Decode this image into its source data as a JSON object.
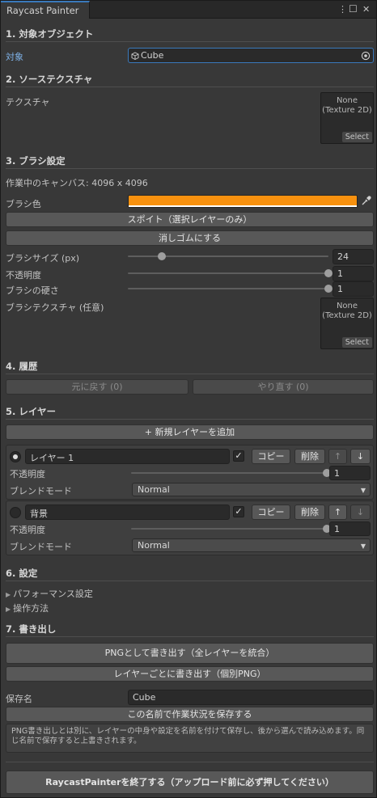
{
  "window": {
    "title": "Raycast Painter",
    "menu_icon": "⋮",
    "maximize_icon": "☐",
    "close_icon": "✕"
  },
  "sections": {
    "target": {
      "header": "1. 対象オブジェクト",
      "label": "対象",
      "value": "Cube",
      "icons": {
        "object": "cube-icon",
        "picker": "object-picker-icon"
      }
    },
    "source": {
      "header": "2. ソーステクスチャ",
      "label": "テクスチャ",
      "thumb_text": "None\n(Texture 2D)",
      "select_label": "Select"
    },
    "brush": {
      "header": "3. ブラシ設定",
      "canvas_info": "作業中のキャンバス: 4096 x 4096",
      "color_label": "ブラシ色",
      "color_hex": "#f7910f",
      "eyedropper_button": "スポイト（選択レイヤーのみ）",
      "eraser_button": "消しゴムにする",
      "size": {
        "label": "ブラシサイズ (px)",
        "value": "24",
        "fraction": 0.17
      },
      "opacity": {
        "label": "不透明度",
        "value": "1",
        "fraction": 1.0
      },
      "hardness": {
        "label": "ブラシの硬さ",
        "value": "1",
        "fraction": 1.0
      },
      "texture_label": "ブラシテクスチャ (任意)",
      "texture_thumb_text": "None\n(Texture 2D)",
      "texture_select_label": "Select"
    },
    "history": {
      "header": "4. 履歴",
      "undo_label": "元に戻す (0)",
      "redo_label": "やり直す (0)"
    },
    "layers": {
      "header": "5. レイヤー",
      "add_button": "+ 新規レイヤーを追加",
      "items": [
        {
          "name": "レイヤー 1",
          "selected": true,
          "visible_check": "✓",
          "copy": "コピー",
          "delete": "削除",
          "up": "↑",
          "down": "↓",
          "opacity_label": "不透明度",
          "opacity_value": "1",
          "opacity_fraction": 1.0,
          "blend_label": "ブレンドモード",
          "blend_value": "Normal"
        },
        {
          "name": "背景",
          "selected": false,
          "visible_check": "✓",
          "copy": "コピー",
          "delete": "削除",
          "up": "↑",
          "down": "↓",
          "opacity_label": "不透明度",
          "opacity_value": "1",
          "opacity_fraction": 1.0,
          "blend_label": "ブレンドモード",
          "blend_value": "Normal"
        }
      ]
    },
    "settings": {
      "header": "6. 設定",
      "performance_label": "パフォーマンス設定",
      "howto_label": "操作方法"
    },
    "export": {
      "header": "7. 書き出し",
      "png_merge_button": "PNGとして書き出す（全レイヤーを統合）",
      "png_each_button": "レイヤーごとに書き出す（個別PNG）",
      "save_name_label": "保存名",
      "save_name_value": "Cube",
      "save_state_button": "この名前で作業状況を保存する",
      "help_text": "PNG書き出しとは別に、レイヤーの中身や設定を名前を付けて保存し、後から選んで読み込めます。同じ名前で保存すると上書きされます。"
    },
    "finish_button": "RaycastPainterを終了する（アップロード前に必ず押してください）"
  }
}
